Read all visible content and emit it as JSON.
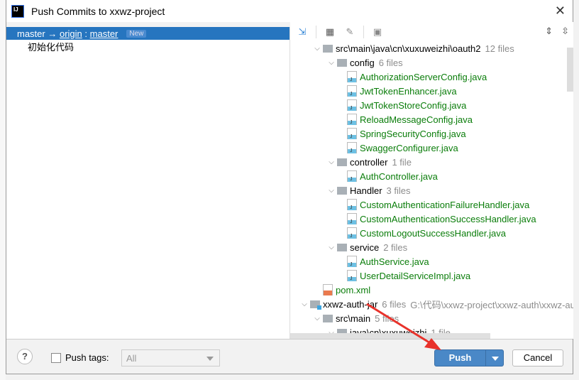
{
  "window": {
    "title": "Push Commits to xxwz-project",
    "close_icon": "close-icon"
  },
  "branch": {
    "local": "master",
    "arrow": "→",
    "remote": "origin",
    "sep": ":",
    "remote_branch": "master",
    "badge": "New"
  },
  "commits": [
    "初始化代码"
  ],
  "tree": [
    {
      "level": 0,
      "type": "folder",
      "name": "src\\main\\java\\cn\\xuxuweizhi\\oauth2",
      "count": "12 files"
    },
    {
      "level": 1,
      "type": "folder",
      "name": "config",
      "count": "6 files"
    },
    {
      "level": 2,
      "type": "java",
      "name": "AuthorizationServerConfig.java"
    },
    {
      "level": 2,
      "type": "java",
      "name": "JwtTokenEnhancer.java"
    },
    {
      "level": 2,
      "type": "java",
      "name": "JwtTokenStoreConfig.java"
    },
    {
      "level": 2,
      "type": "java",
      "name": "ReloadMessageConfig.java"
    },
    {
      "level": 2,
      "type": "java",
      "name": "SpringSecurityConfig.java"
    },
    {
      "level": 2,
      "type": "java",
      "name": "SwaggerConfigurer.java"
    },
    {
      "level": 1,
      "type": "folder",
      "name": "controller",
      "count": "1 file"
    },
    {
      "level": 2,
      "type": "java",
      "name": "AuthController.java"
    },
    {
      "level": 1,
      "type": "folder",
      "name": "Handler",
      "count": "3 files"
    },
    {
      "level": 2,
      "type": "java",
      "name": "CustomAuthenticationFailureHandler.java"
    },
    {
      "level": 2,
      "type": "java",
      "name": "CustomAuthenticationSuccessHandler.java"
    },
    {
      "level": 2,
      "type": "java",
      "name": "CustomLogoutSuccessHandler.java"
    },
    {
      "level": 1,
      "type": "folder",
      "name": "service",
      "count": "2 files"
    },
    {
      "level": 2,
      "type": "java",
      "name": "AuthService.java"
    },
    {
      "level": 2,
      "type": "java",
      "name": "UserDetailServiceImpl.java"
    },
    {
      "level": 0.5,
      "type": "xml",
      "name": "pom.xml"
    },
    {
      "level": -1,
      "type": "module",
      "name": "xxwz-auth-jar",
      "count": "6 files",
      "path": "G:\\代码\\xxwz-project\\xxwz-auth\\xxwz-auth-jar"
    },
    {
      "level": 0,
      "type": "folder",
      "name": "src\\main",
      "count": "5 files"
    },
    {
      "level": 1,
      "type": "folder",
      "name": "java\\cn\\xuxuweizhi",
      "count": "1 file"
    }
  ],
  "footer": {
    "help": "?",
    "push_tags_label": "Push tags:",
    "push_tags_checked": false,
    "tags_select": "All",
    "push": "Push",
    "cancel": "Cancel"
  },
  "colors": {
    "selection": "#2675bf",
    "file_added": "#0a7d0a",
    "primary_button": "#4a88c7",
    "annotation_arrow": "#e8322b"
  }
}
